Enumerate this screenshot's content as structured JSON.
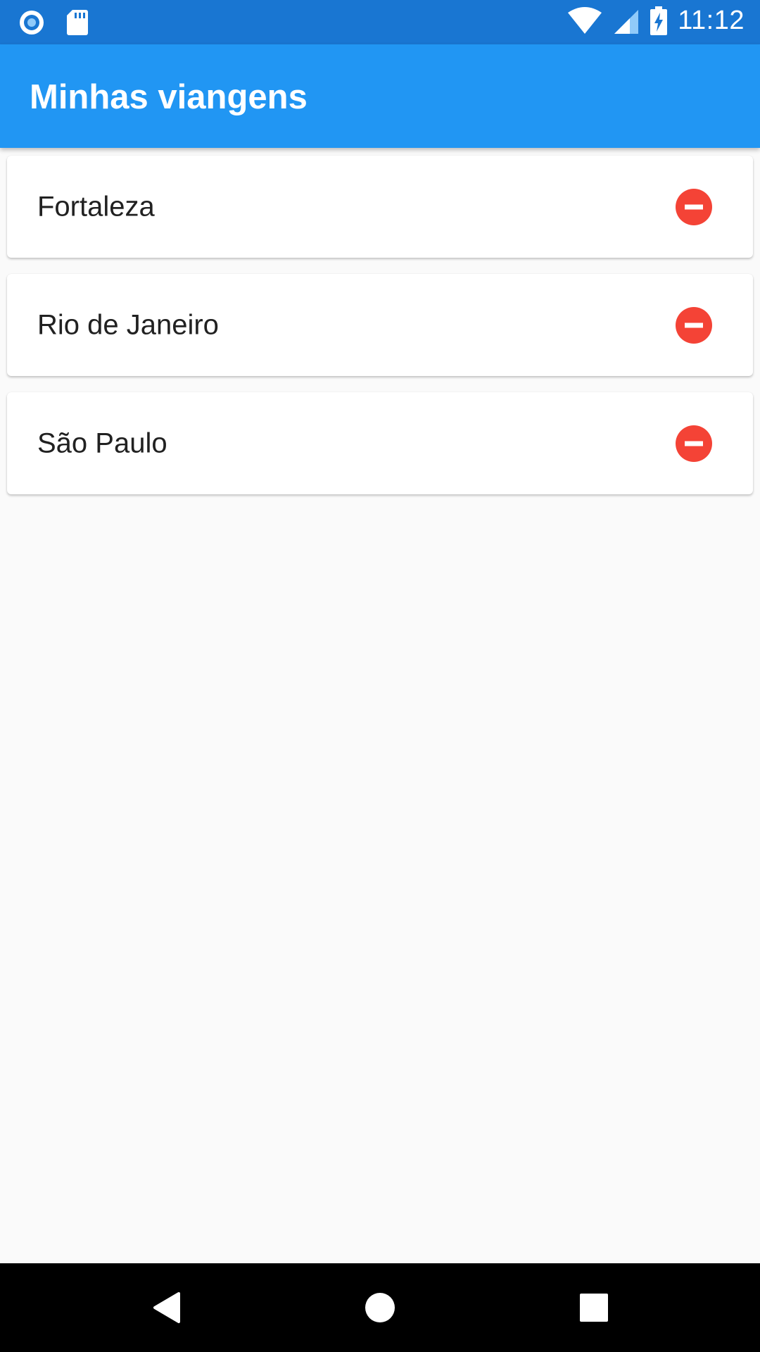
{
  "status_bar": {
    "time": "11:12",
    "icons_left": [
      "record-icon",
      "sd-card-icon"
    ],
    "icons_right": [
      "wifi-icon",
      "cell-signal-icon",
      "battery-charging-icon"
    ]
  },
  "app_bar": {
    "title": "Minhas viangens"
  },
  "trips": [
    {
      "name": "Fortaleza",
      "action_icon": "remove-circle-icon"
    },
    {
      "name": "Rio de Janeiro",
      "action_icon": "remove-circle-icon"
    },
    {
      "name": "São Paulo",
      "action_icon": "remove-circle-icon"
    }
  ],
  "nav_bar": {
    "buttons": [
      "back-icon",
      "home-icon",
      "recents-icon"
    ]
  },
  "colors": {
    "status_bar": "#1976d2",
    "app_bar": "#2196f3",
    "remove_icon": "#f44336",
    "background": "#fafafa"
  }
}
